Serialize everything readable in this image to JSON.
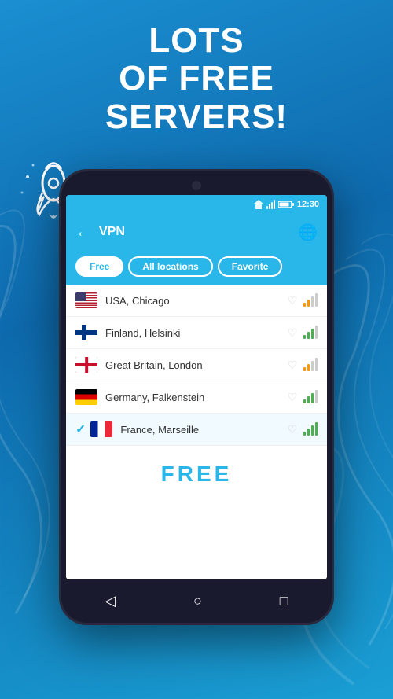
{
  "hero": {
    "line1": "Lots",
    "line2": "of free",
    "line3": "servers!"
  },
  "status_bar": {
    "time": "12:30",
    "signal": "▼▲",
    "wifi": "WiFi",
    "battery": "🔋"
  },
  "nav": {
    "title": "VPN",
    "back_label": "←",
    "globe_label": "🌐"
  },
  "tabs": [
    {
      "id": "free",
      "label": "Free",
      "active": true
    },
    {
      "id": "all",
      "label": "All locations",
      "active": false
    },
    {
      "id": "favorite",
      "label": "Favorite",
      "active": false
    }
  ],
  "servers": [
    {
      "id": "usa",
      "name": "USA, Chicago",
      "flag": "usa",
      "selected": false,
      "favorited": false,
      "signal_strength": 2
    },
    {
      "id": "finland",
      "name": "Finland, Helsinki",
      "flag": "finland",
      "selected": false,
      "favorited": false,
      "signal_strength": 3
    },
    {
      "id": "uk",
      "name": "Great Britain, London",
      "flag": "uk",
      "selected": false,
      "favorited": false,
      "signal_strength": 2
    },
    {
      "id": "germany",
      "name": "Germany, Falkenstein",
      "flag": "germany",
      "selected": false,
      "favorited": false,
      "signal_strength": 3
    },
    {
      "id": "france",
      "name": "France, Marseille",
      "flag": "france",
      "selected": true,
      "favorited": false,
      "signal_strength": 3
    }
  ],
  "free_label": "FREE",
  "bottom_nav": {
    "back": "◁",
    "home": "○",
    "menu": "□"
  }
}
